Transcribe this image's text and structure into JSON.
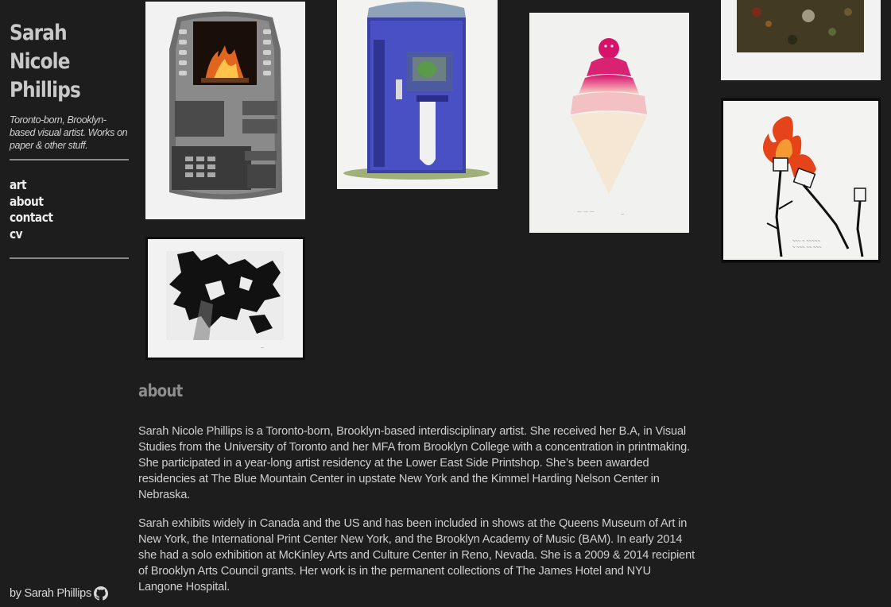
{
  "site": {
    "title_lines": [
      "Sarah",
      "Nicole",
      "Phillips"
    ],
    "tagline": "Toronto-born, Brooklyn-based visual artist. Works on paper & other stuff."
  },
  "nav": {
    "items": [
      "art",
      "about",
      "contact",
      "cv"
    ]
  },
  "gallery": {
    "items": [
      {
        "subject": "atm-fireplace"
      },
      {
        "subject": "portable-toilet-atm"
      },
      {
        "subject": "ice-cream-cone"
      },
      {
        "subject": "forest-photo"
      },
      {
        "subject": "black-white-abstract"
      },
      {
        "subject": "burning-marshmallows"
      }
    ]
  },
  "about": {
    "heading": "about",
    "paragraphs": [
      "Sarah Nicole Phillips is a Toronto-born, Brooklyn-based interdisciplinary artist. She received her B.A, in Visual Studies from the University of Toronto and her MFA from Brooklyn College with a concentration in printmaking. She participated in a year-long artist residency at the Lower East Side Printshop. She’s been awarded residencies at The Blue Mountain Center in upstate New York and the Kimmel Harding Nelson Center in Nebraska.",
      "Sarah exhibits widely in Canada and the US and has been included in shows at the Queens Museum of Art in New York, the International Print Center New York, and the Brooklyn Academy of Music (BAM). In early 2014 she had a solo exhibition at McKinley Arts and Culture Center in Reno, Nevada. She is a 2009 & 2014 recipient of Brooklyn Arts Council grants. Her work is in the permanent collections of The James Hotel and NYU Langone Hospital."
    ]
  },
  "footer": {
    "credit": "by Sarah Phillips",
    "icon": "github-icon"
  },
  "colors": {
    "background": "#1d1d1d",
    "text": "#cfcfcf",
    "heading_muted": "#8d8d8d",
    "rule": "#8a8a8a"
  }
}
